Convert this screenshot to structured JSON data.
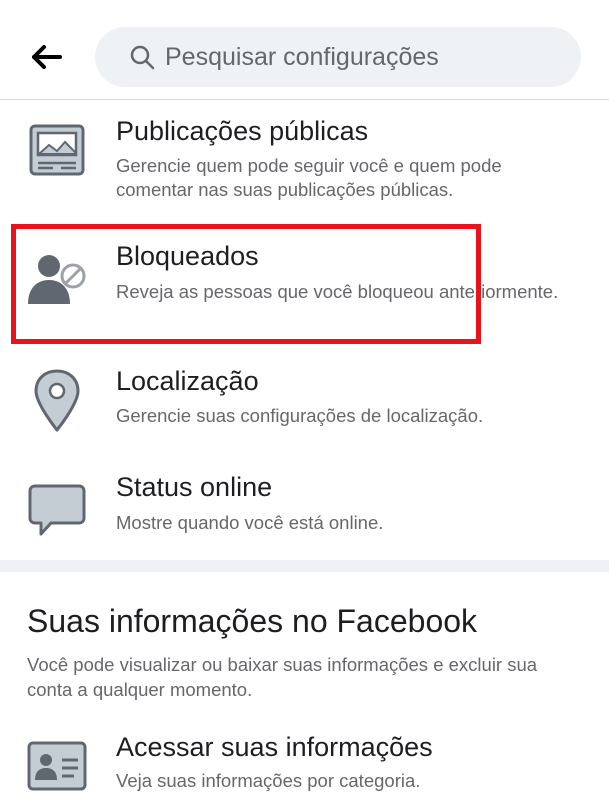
{
  "header": {
    "back_label": "",
    "search_placeholder": "Pesquisar configurações"
  },
  "items": [
    {
      "id": "publicacoes",
      "icon": "public-posts-icon",
      "title": "Publicações públicas",
      "desc": "Gerencie quem pode seguir você e quem pode comentar nas suas publicações públicas."
    },
    {
      "id": "bloqueados",
      "icon": "blocked-user-icon",
      "title": "Bloqueados",
      "desc": "Reveja as pessoas que você bloqueou anteriormente."
    },
    {
      "id": "localizacao",
      "icon": "location-pin-icon",
      "title": "Localização",
      "desc": "Gerencie suas configurações de localização."
    },
    {
      "id": "status",
      "icon": "chat-bubble-icon",
      "title": "Status online",
      "desc": "Mostre quando você está online."
    }
  ],
  "info_section": {
    "title": "Suas informações no Facebook",
    "desc": "Você pode visualizar ou baixar suas informações e excluir sua conta a qualquer momento.",
    "access_item": {
      "icon": "id-card-icon",
      "title": "Acessar suas informações",
      "desc": "Veja suas informações por categoria."
    }
  },
  "colors": {
    "highlight": "#e8131c",
    "icon_gray": "#606770",
    "icon_fill": "#c4ccd4",
    "text_secondary": "#65676b"
  }
}
